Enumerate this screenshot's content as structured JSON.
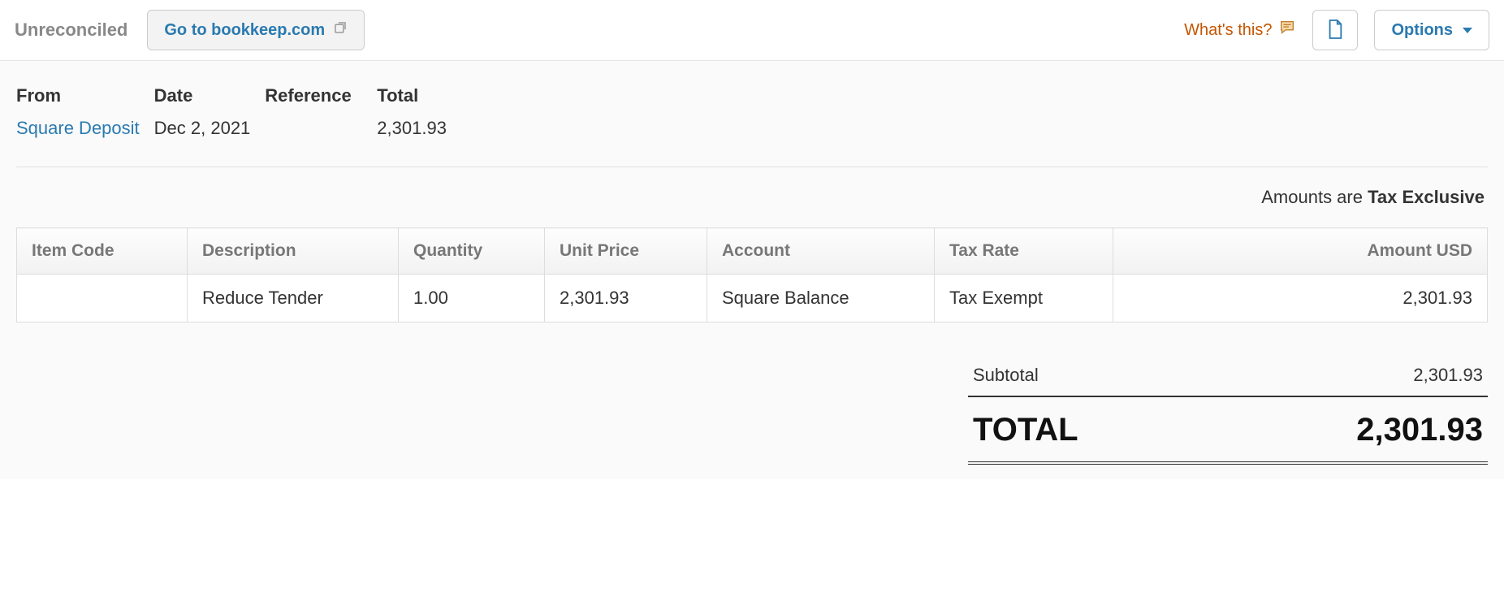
{
  "header": {
    "status": "Unreconciled",
    "bookkeep_label": "Go to bookkeep.com",
    "whats_this": "What's this?",
    "options_label": "Options"
  },
  "meta": {
    "headers": {
      "from": "From",
      "date": "Date",
      "reference": "Reference",
      "total": "Total"
    },
    "values": {
      "from": "Square Deposit",
      "date": "Dec 2, 2021",
      "reference": "",
      "total": "2,301.93"
    }
  },
  "amounts_note": {
    "prefix": "Amounts are ",
    "emphasis": "Tax Exclusive"
  },
  "table": {
    "headers": {
      "item_code": "Item Code",
      "description": "Description",
      "quantity": "Quantity",
      "unit_price": "Unit Price",
      "account": "Account",
      "tax_rate": "Tax Rate",
      "amount": "Amount USD"
    },
    "rows": [
      {
        "item_code": "",
        "description": "Reduce Tender",
        "quantity": "1.00",
        "unit_price": "2,301.93",
        "account": "Square Balance",
        "tax_rate": "Tax Exempt",
        "amount": "2,301.93"
      }
    ]
  },
  "totals": {
    "subtotal_label": "Subtotal",
    "subtotal_value": "2,301.93",
    "total_label": "TOTAL",
    "total_value": "2,301.93"
  }
}
